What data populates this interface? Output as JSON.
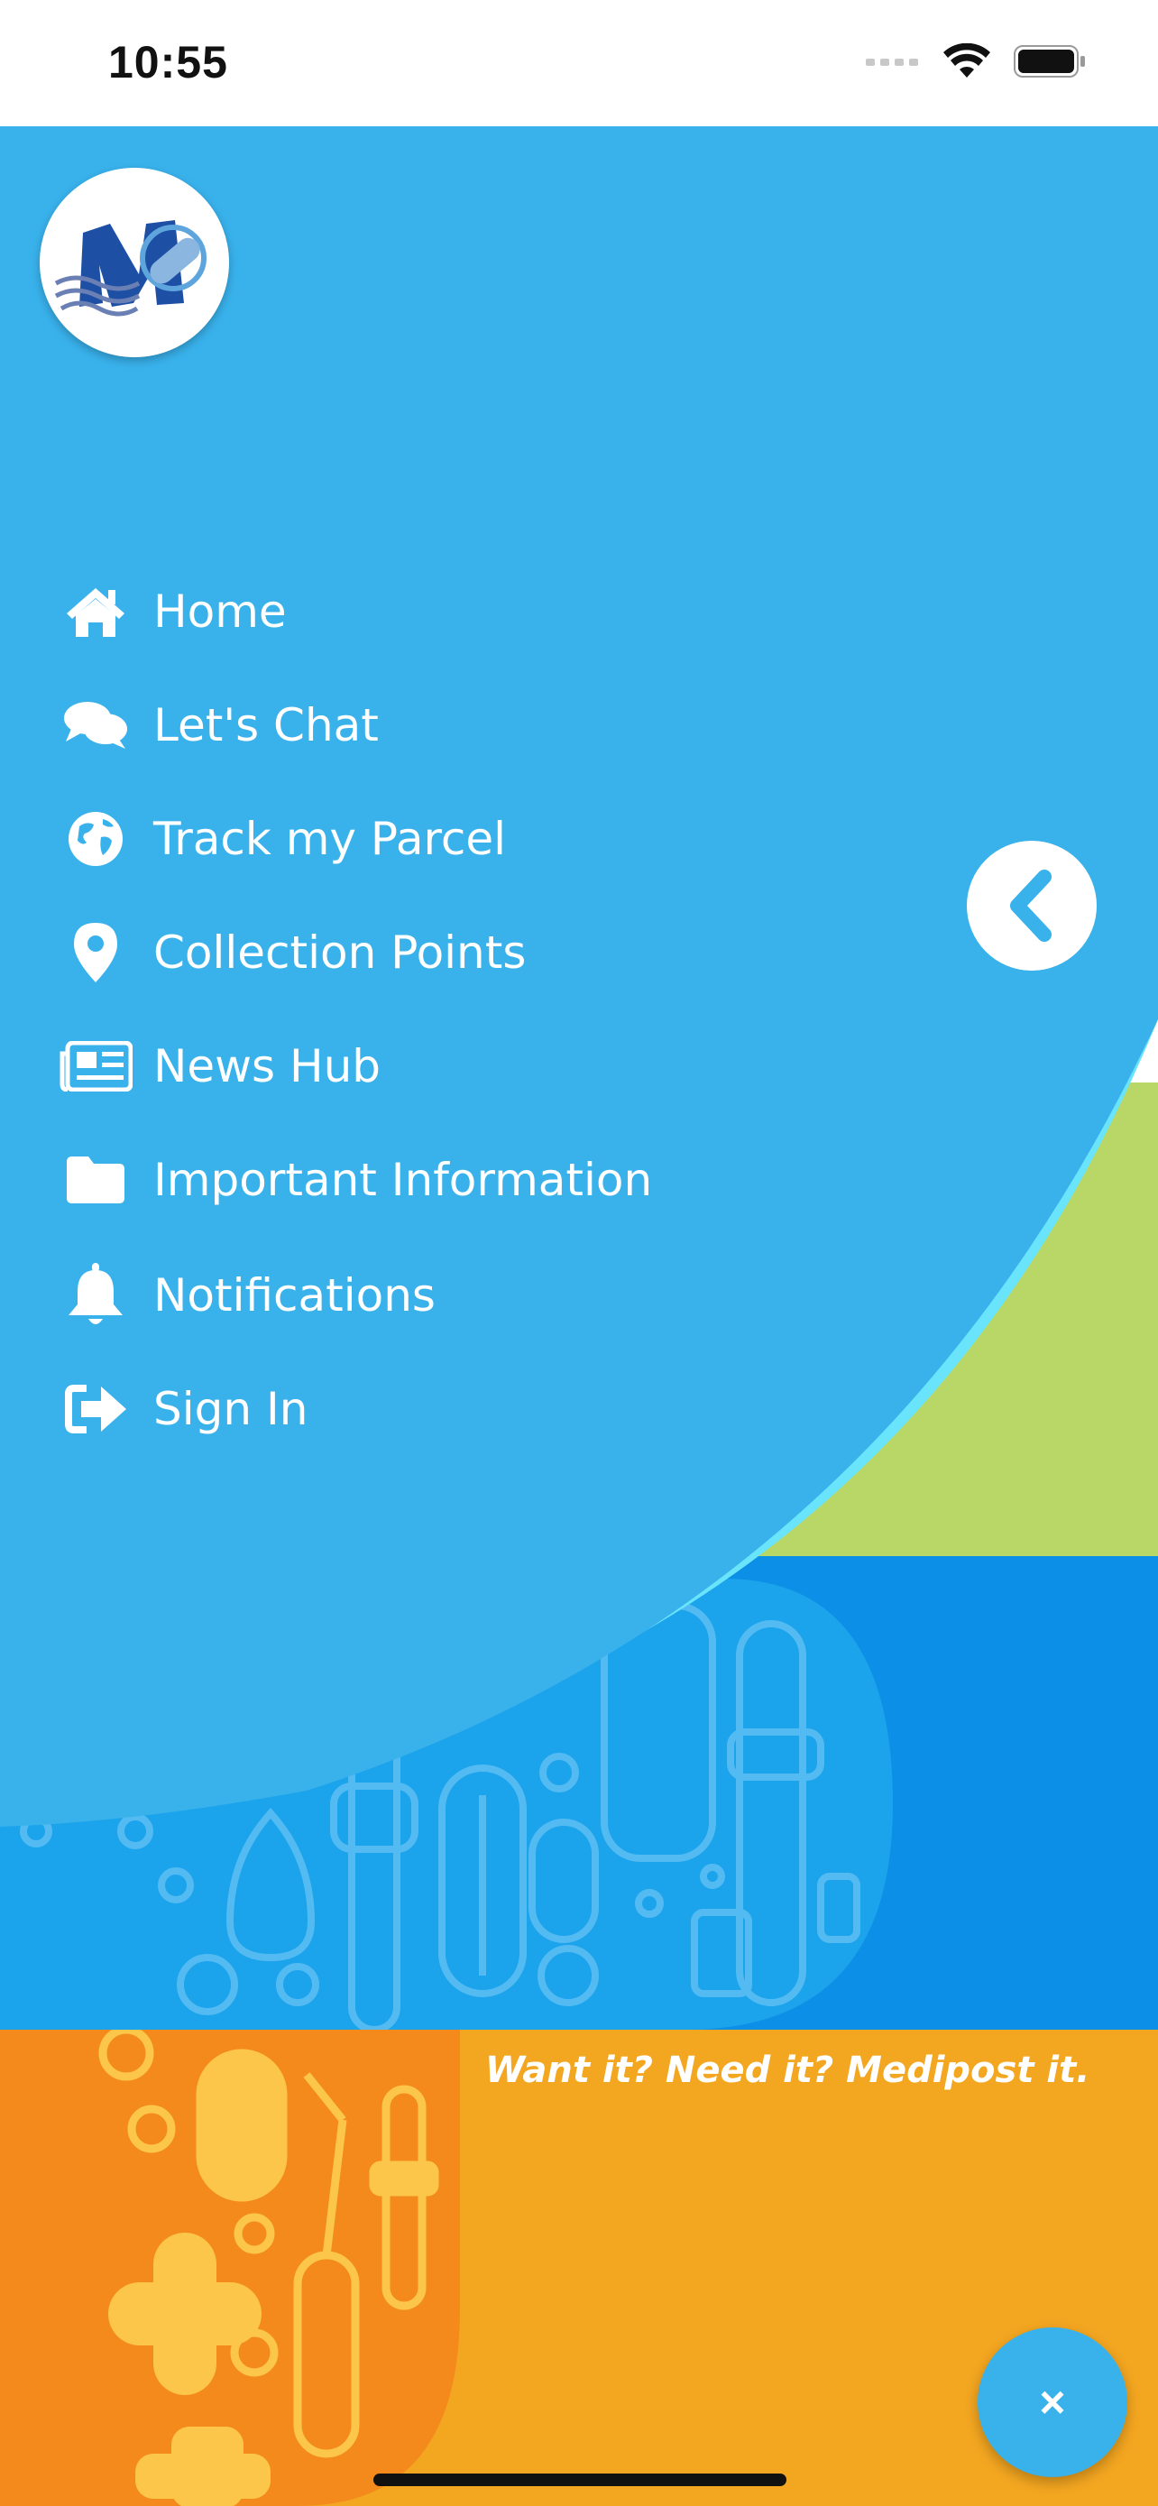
{
  "status_bar": {
    "time": "10:55",
    "battery_icon": "battery-icon",
    "wifi_icon": "wifi-icon",
    "signal_icon": "signal-icon"
  },
  "logo": {
    "icon": "medipost-logo"
  },
  "menu": {
    "items": [
      {
        "label": "Home",
        "icon": "home-icon"
      },
      {
        "label": "Let's Chat",
        "icon": "chat-icon"
      },
      {
        "label": "Track my Parcel",
        "icon": "globe-icon"
      },
      {
        "label": "Collection Points",
        "icon": "map-pin-icon"
      },
      {
        "label": "News Hub",
        "icon": "newspaper-icon"
      },
      {
        "label": "Important Information",
        "icon": "folder-icon"
      },
      {
        "label": "Notifications",
        "icon": "bell-icon"
      },
      {
        "label": "Sign In",
        "icon": "sign-in-icon"
      }
    ]
  },
  "back_button": {
    "icon": "chevron-left-icon"
  },
  "banner": {
    "tagline": "Want it? Need it? Medipost it."
  },
  "close_button": {
    "label": "×",
    "icon": "close-icon"
  },
  "colors": {
    "primary_blue": "#39b2ec",
    "light_cyan": "#69e4fb",
    "deep_blue": "#0c8fe6",
    "green": "#b8d766",
    "orange": "#f0a023"
  }
}
